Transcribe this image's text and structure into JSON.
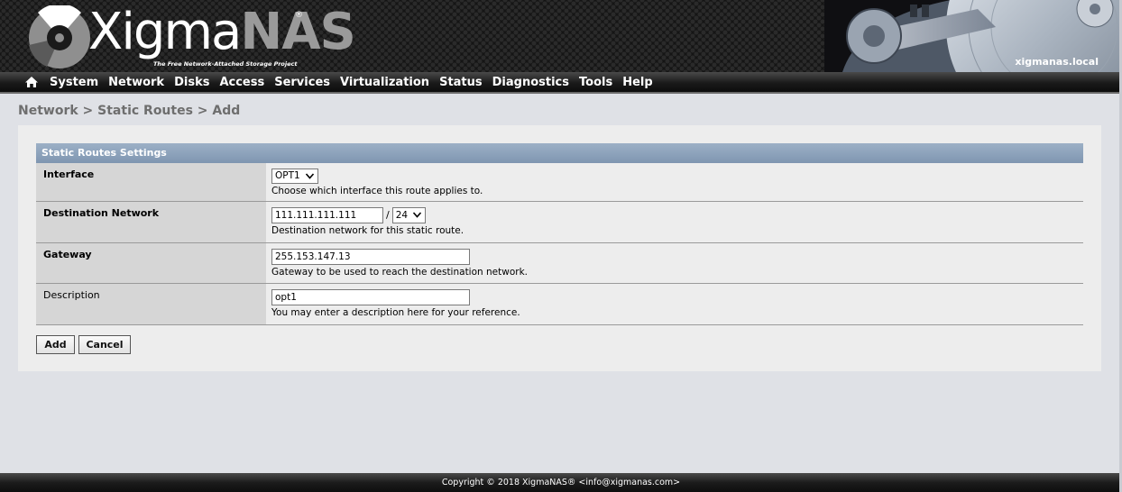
{
  "header": {
    "logo_main": "Xigma",
    "logo_accent": "NAS",
    "logo_registered": "®",
    "tagline": "The Free Network-Attached Storage Project",
    "hostname": "xigmanas.local"
  },
  "nav": {
    "home_icon": "home-icon",
    "items": [
      "System",
      "Network",
      "Disks",
      "Access",
      "Services",
      "Virtualization",
      "Status",
      "Diagnostics",
      "Tools",
      "Help"
    ]
  },
  "breadcrumb": "Network > Static Routes > Add",
  "section": {
    "title": "Static Routes Settings"
  },
  "form": {
    "interface": {
      "label": "Interface",
      "value": "OPT1",
      "hint": "Choose which interface this route applies to."
    },
    "destination": {
      "label": "Destination Network",
      "network": "111.111.111.111",
      "separator": "/",
      "mask": "24",
      "hint": "Destination network for this static route."
    },
    "gateway": {
      "label": "Gateway",
      "value": "255.153.147.13",
      "hint": "Gateway to be used to reach the destination network."
    },
    "description": {
      "label": "Description",
      "value": "opt1",
      "hint": "You may enter a description here for your reference."
    }
  },
  "buttons": {
    "add": "Add",
    "cancel": "Cancel"
  },
  "footer": "Copyright © 2018 XigmaNAS® <info@xigmanas.com>",
  "colors": {
    "section_header": "#8aa0b9",
    "label_cell": "#d6d6d6",
    "panel": "#ededed",
    "page_bg": "#dfe1e6"
  }
}
